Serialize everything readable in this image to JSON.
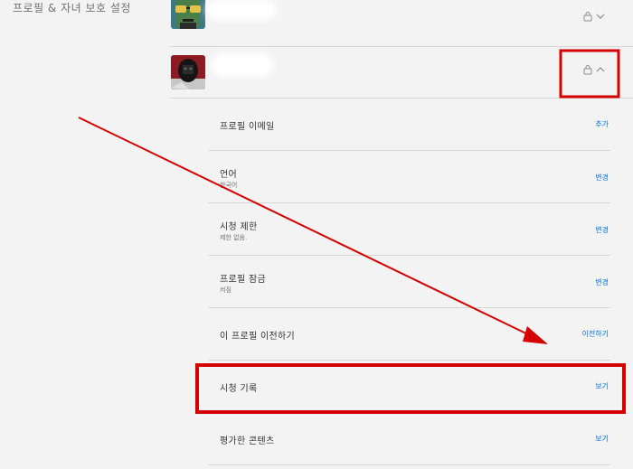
{
  "section": {
    "title": "프로필 & 자녀 보호 설정"
  },
  "profiles": [
    {
      "avatar": "sunglasses-face-avatar",
      "name_hidden": true,
      "controls": [
        "lock-icon",
        "chevron-down-icon"
      ]
    },
    {
      "avatar": "masked-guard-avatar",
      "name_hidden": true,
      "controls": [
        "lock-icon",
        "chevron-up-icon"
      ]
    }
  ],
  "settings": [
    {
      "label": "프로필 이메일",
      "sub": "",
      "action": "추가"
    },
    {
      "label": "언어",
      "sub": "한국어",
      "action": "변경"
    },
    {
      "label": "시청 제한",
      "sub": "제한 없음.",
      "action": "변경"
    },
    {
      "label": "프로필 잠금",
      "sub": "켜짐",
      "action": "변경"
    },
    {
      "label": "이 프로필 이전하기",
      "sub": "",
      "action": "이전하기"
    },
    {
      "label": "시청 기록",
      "sub": "",
      "action": "보기"
    },
    {
      "label": "평가한 콘텐츠",
      "sub": "",
      "action": "보기"
    }
  ],
  "colors": {
    "accent_link": "#0071eb",
    "annotation_red": "#d40000",
    "background": "#f3f3f3"
  }
}
